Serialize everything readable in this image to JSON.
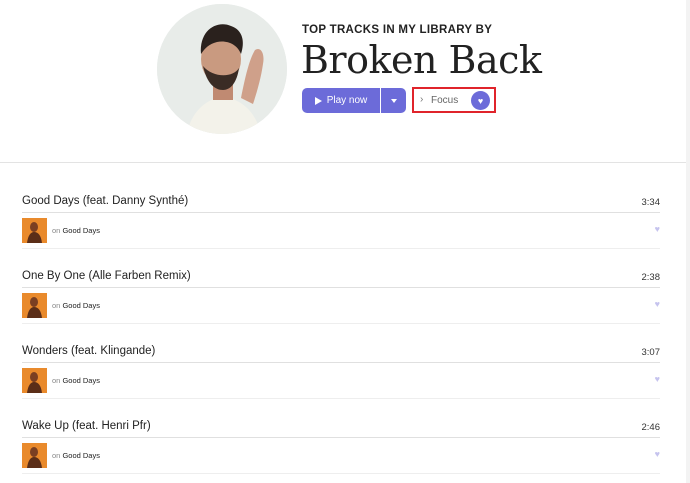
{
  "artist": {
    "subtitle": "TOP TRACKS IN MY LIBRARY BY",
    "name": "Broken Back",
    "avatar_icon": "artist-photo"
  },
  "actions": {
    "play_label": "Play now",
    "play_icon": "play-icon",
    "dropdown_icon": "chevron-down-icon",
    "focus_arrow": "›",
    "focus_label": "Focus",
    "favorite_icon": "♥"
  },
  "colors": {
    "accent": "#6c6bd9",
    "highlight_border": "#e0242b",
    "like_icon": "#c5c3ee",
    "cover": "#e98a2c"
  },
  "tracks": [
    {
      "title": "Good Days (feat. Danny Synthé)",
      "duration": "3:34",
      "on": "on",
      "album": "Good Days",
      "like_icon": "♥"
    },
    {
      "title": "One By One (Alle Farben Remix)",
      "duration": "2:38",
      "on": "on",
      "album": "Good Days",
      "like_icon": "♥"
    },
    {
      "title": "Wonders (feat. Klingande)",
      "duration": "3:07",
      "on": "on",
      "album": "Good Days",
      "like_icon": "♥"
    },
    {
      "title": "Wake Up (feat. Henri Pfr)",
      "duration": "2:46",
      "on": "on",
      "album": "Good Days",
      "like_icon": "♥"
    }
  ]
}
